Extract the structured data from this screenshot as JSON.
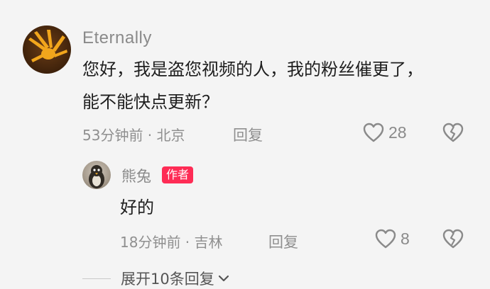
{
  "comment": {
    "username": "Eternally",
    "text_line_1": "您好，我是盗您视频的人，我的粉丝催更了，",
    "text_line_2": "能不能快点更新？",
    "time_location": "53分钟前 · 北京",
    "reply_label": "回复",
    "like_count": "28",
    "avatar_icon": "hand-avatar-icon"
  },
  "reply": {
    "username": "熊兔",
    "badge": "作者",
    "text": "好的",
    "time_location": "18分钟前 · 吉林",
    "reply_label": "回复",
    "like_count": "8",
    "avatar_icon": "penguin-avatar-icon"
  },
  "expand": {
    "label": "展开10条回复"
  },
  "colors": {
    "background": "#f4f4f4",
    "text": "#1e1e1e",
    "meta": "#8f8f8f",
    "badge": "#fe2c55"
  }
}
